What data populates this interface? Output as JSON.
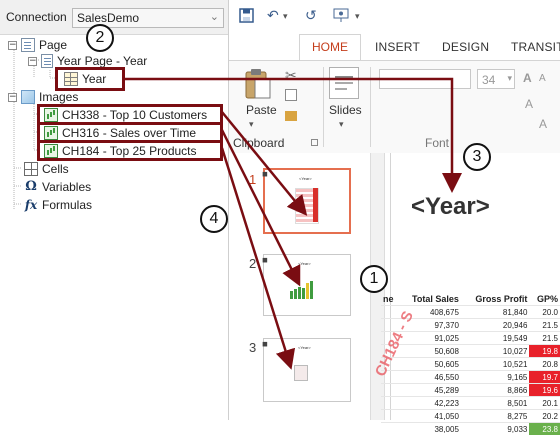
{
  "connection": {
    "label": "Connection",
    "value": "SalesDemo"
  },
  "tree": {
    "page": "Page",
    "year_page": "Year Page - Year",
    "year": "Year",
    "images": "Images",
    "images_items": [
      "CH338 - Top 10 Customers",
      "CH316 - Sales over Time",
      "CH184 - Top 25 Products"
    ],
    "cells": "Cells",
    "variables": "Variables",
    "formulas": "Formulas"
  },
  "ribbon": {
    "tabs": [
      "HOME",
      "INSERT",
      "DESIGN",
      "TRANSIT"
    ],
    "paste": "Paste",
    "clipboard": "Clipboard",
    "slides": "Slides",
    "font_group": "Font",
    "font_size": "34"
  },
  "thumbnails": [
    {
      "num": "1",
      "title": "<Year>"
    },
    {
      "num": "2",
      "title": "<Year>"
    },
    {
      "num": "3",
      "title": "<Year>"
    }
  ],
  "slide": {
    "placeholder": "<Year>",
    "watermark": "CH184 - S",
    "table": {
      "headers": [
        "ne",
        "Total Sales",
        "Gross Profit",
        "GP%"
      ],
      "rows": [
        [
          "408,675",
          "81,840",
          "20.0"
        ],
        [
          "97,370",
          "20,946",
          "21.5"
        ],
        [
          "91,025",
          "19,549",
          "21.5"
        ],
        [
          "50,608",
          "10,027",
          "19.8"
        ],
        [
          "50,605",
          "10,521",
          "20.8"
        ],
        [
          "46,550",
          "9,165",
          "19.7"
        ],
        [
          "45,289",
          "8,866",
          "19.6"
        ],
        [
          "42,223",
          "8,501",
          "20.1"
        ],
        [
          "41,050",
          "8,275",
          "20.2"
        ],
        [
          "38,005",
          "9,033",
          "23.8"
        ]
      ],
      "highlight_rows": {
        "3": "#e8212a",
        "5": "#e8212a",
        "6": "#e8212a",
        "9": "#6ab04c"
      }
    }
  },
  "callouts": [
    "1",
    "2",
    "3",
    "4"
  ],
  "colors": {
    "annotation": "#7a0d12",
    "accent": "#c43e1c",
    "thumb_selected": "#e56f4f"
  },
  "icons": {
    "save": "save-icon",
    "undo": "undo-icon",
    "redo": "redo-icon",
    "present": "present-icon",
    "paste": "paste-icon",
    "cut": "cut-icon",
    "slides": "new-slide-icon"
  }
}
